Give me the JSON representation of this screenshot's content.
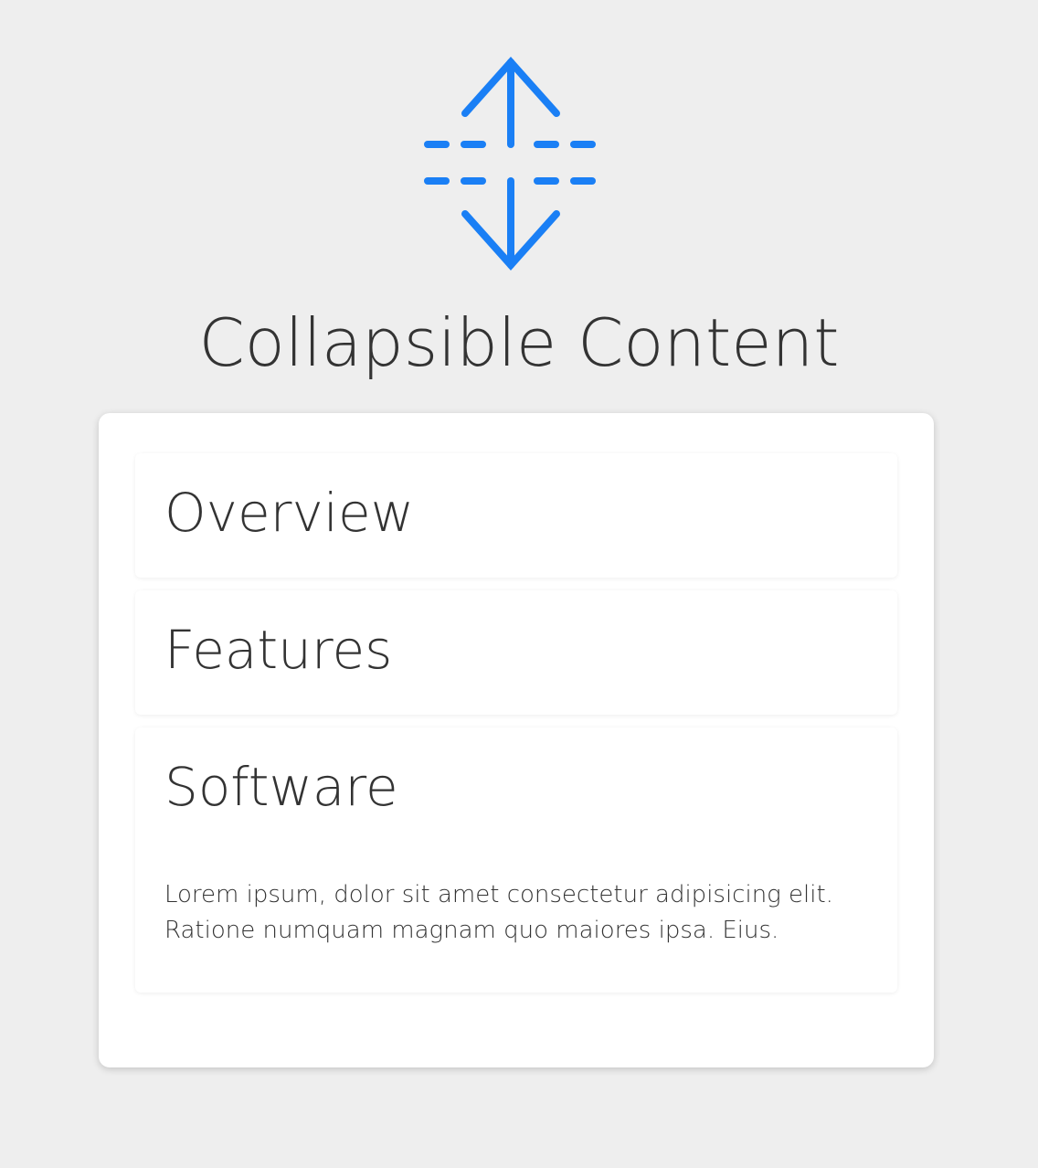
{
  "logo": {
    "icon": "expand-collapse-icon",
    "color": "#1a7ff5"
  },
  "title": "Collapsible Content",
  "accordion": {
    "items": [
      {
        "label": "Overview",
        "expanded": false
      },
      {
        "label": "Features",
        "expanded": false
      },
      {
        "label": "Software",
        "expanded": true,
        "content_line1": "Lorem ipsum, dolor sit amet consectetur adipisicing elit.",
        "content_line2": "Ratione numquam magnam quo maiores ipsa. Eius."
      }
    ]
  }
}
